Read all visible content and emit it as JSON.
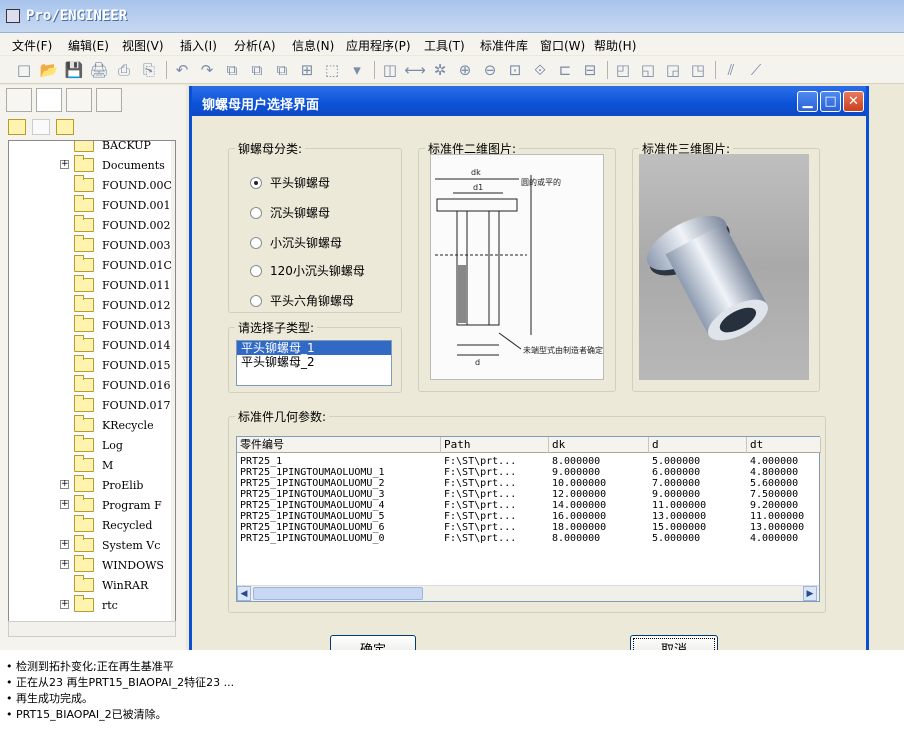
{
  "app": {
    "title": "Pro/ENGINEER"
  },
  "menu": [
    "文件(F)",
    "编辑(E)",
    "视图(V)",
    "插入(I)",
    "分析(A)",
    "信息(N)",
    "应用程序(P)",
    "工具(T)",
    "标准件库",
    "窗口(W)",
    "帮助(H)"
  ],
  "tree": {
    "items": [
      "BACKUP",
      "Documents",
      "FOUND.000",
      "FOUND.001",
      "FOUND.002",
      "FOUND.003",
      "FOUND.010",
      "FOUND.011",
      "FOUND.012",
      "FOUND.013",
      "FOUND.014",
      "FOUND.015",
      "FOUND.016",
      "FOUND.017",
      "KRecycle",
      "Log",
      "M",
      "ProElib",
      "Program F",
      "Recycled",
      "System Vo",
      "WINDOWS",
      "WinRAR",
      "rtc"
    ],
    "visible_labels": [
      "BACKUP",
      "Documents",
      "FOUND.00C",
      "FOUND.001",
      "FOUND.002",
      "FOUND.003",
      "FOUND.01C",
      "FOUND.011",
      "FOUND.012",
      "FOUND.013",
      "FOUND.014",
      "FOUND.015",
      "FOUND.016",
      "FOUND.017",
      "KRecycle",
      "Log",
      "M",
      "ProElib",
      "Program F",
      "Recycled",
      "System Vc",
      "WINDOWS",
      "WinRAR",
      "rtc"
    ]
  },
  "dialog": {
    "title": "铆螺母用户选择界面",
    "category_legend": "铆螺母分类:",
    "categories": [
      "平头铆螺母",
      "沉头铆螺母",
      "小沉头铆螺母",
      "120小沉头铆螺母",
      "平头六角铆螺母"
    ],
    "selected_category": 0,
    "subtype_legend": "请选择子类型:",
    "subtypes": [
      "平头铆螺母_1",
      "平头铆螺母_2"
    ],
    "img2d_legend": "标准件二维图片:",
    "img3d_legend": "标准件三维图片:",
    "img2d_labels": {
      "dk": "dk",
      "d1": "d1",
      "rounded": "圆的或平的",
      "note": "未端型式由制造者确定",
      "d": "d"
    },
    "params_legend": "标准件几何参数:",
    "columns": [
      "零件编号",
      "Path",
      "dk",
      "d",
      "dt"
    ],
    "rows": [
      [
        "PRT25_1",
        "F:\\ST\\prt...",
        "8.000000",
        "5.000000",
        "4.000000"
      ],
      [
        "PRT25_1PINGTOUMAOLUOMU_1",
        "F:\\ST\\prt...",
        "9.000000",
        "6.000000",
        "4.800000"
      ],
      [
        "PRT25_1PINGTOUMAOLUOMU_2",
        "F:\\ST\\prt...",
        "10.000000",
        "7.000000",
        "5.600000"
      ],
      [
        "PRT25_1PINGTOUMAOLUOMU_3",
        "F:\\ST\\prt...",
        "12.000000",
        "9.000000",
        "7.500000"
      ],
      [
        "PRT25_1PINGTOUMAOLUOMU_4",
        "F:\\ST\\prt...",
        "14.000000",
        "11.000000",
        "9.200000"
      ],
      [
        "PRT25_1PINGTOUMAOLUOMU_5",
        "F:\\ST\\prt...",
        "16.000000",
        "13.000000",
        "11.000000"
      ],
      [
        "PRT25_1PINGTOUMAOLUOMU_6",
        "F:\\ST\\prt...",
        "18.000000",
        "15.000000",
        "13.000000"
      ],
      [
        "PRT25_1PINGTOUMAOLUOMU_0",
        "F:\\ST\\prt...",
        "8.000000",
        "5.000000",
        "4.000000"
      ]
    ],
    "ok_label": "确定",
    "cancel_label": "取消"
  },
  "messages": [
    "检测到拓扑变化;正在再生基准平",
    "正在从23 再生PRT15_BIAOPAI_2特征23 ...",
    "再生成功完成。",
    "PRT15_BIAOPAI_2已被清除。"
  ],
  "colors": {
    "dialog_title": "#0a52d8",
    "selection": "#316ac5",
    "close": "#c8401f"
  }
}
